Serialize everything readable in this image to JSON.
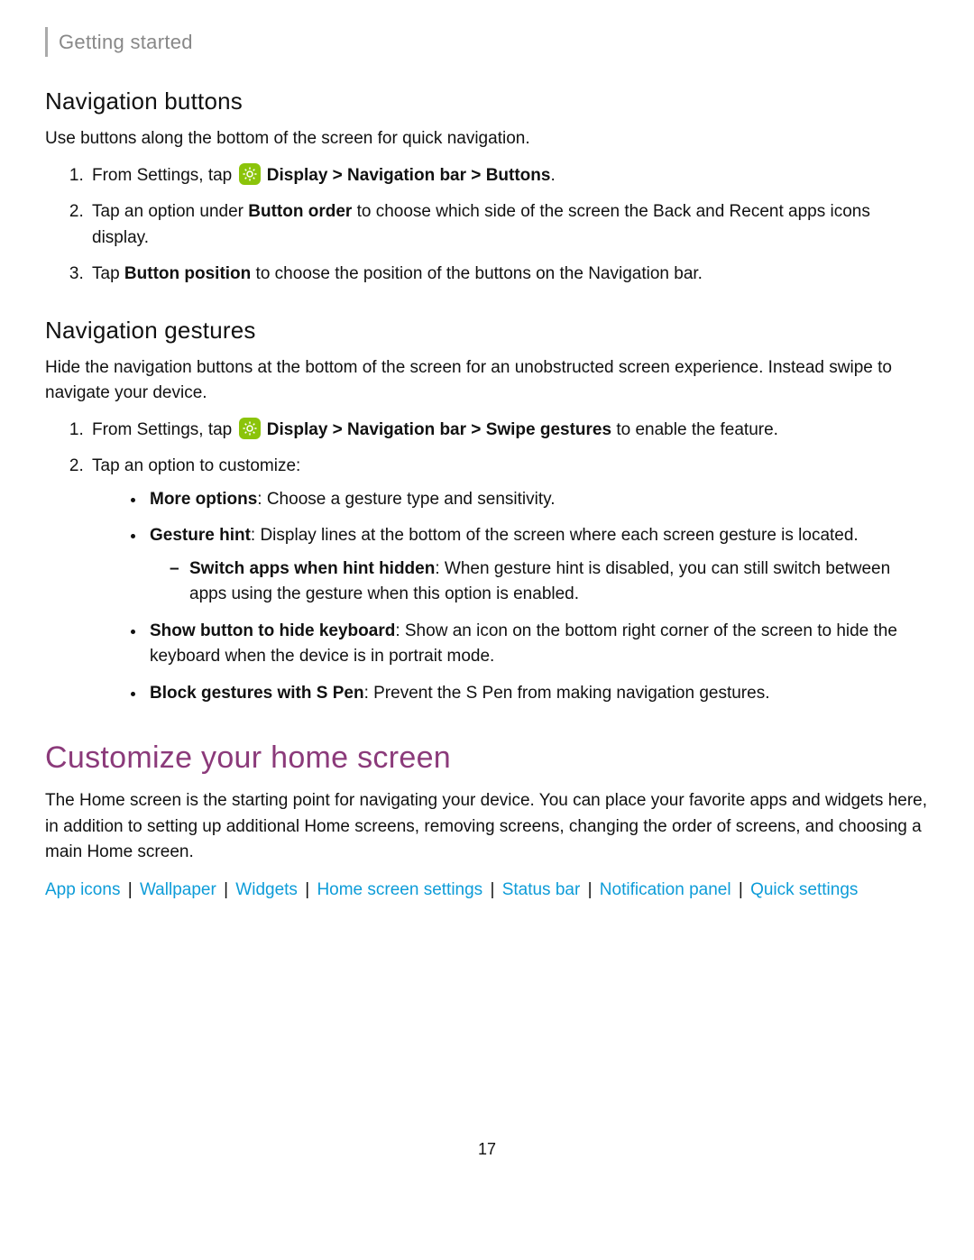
{
  "header": {
    "section": "Getting started"
  },
  "navButtons": {
    "heading": "Navigation buttons",
    "intro": "Use buttons along the bottom of the screen for quick navigation.",
    "step1_pre": "From Settings, tap ",
    "step1_b1": "Display",
    "step1_sep1": " > ",
    "step1_b2": "Navigation bar",
    "step1_sep2": " > ",
    "step1_b3": "Buttons",
    "step1_post": ".",
    "step2_pre": "Tap an option under ",
    "step2_b": "Button order",
    "step2_post": " to choose which side of the screen the Back and Recent apps icons display.",
    "step3_pre": "Tap ",
    "step3_b": "Button position",
    "step3_post": " to choose the position of the buttons on the Navigation bar."
  },
  "navGestures": {
    "heading": "Navigation gestures",
    "intro": "Hide the navigation buttons at the bottom of the screen for an unobstructed screen experience. Instead swipe to navigate your device.",
    "step1_pre": "From Settings, tap ",
    "step1_b1": "Display",
    "step1_sep1": " > ",
    "step1_b2": "Navigation bar",
    "step1_sep2": " > ",
    "step1_b3": "Swipe gestures",
    "step1_post": " to enable the feature.",
    "step2": "Tap an option to customize:",
    "bullets": {
      "more_b": "More options",
      "more_t": ": Choose a gesture type and sensitivity.",
      "hint_b": "Gesture hint",
      "hint_t": ": Display lines at the bottom of the screen where each screen gesture is located.",
      "switch_b": "Switch apps when hint hidden",
      "switch_t": ": When gesture hint is disabled, you can still switch between apps using the gesture when this option is enabled.",
      "kbd_b": "Show button to hide keyboard",
      "kbd_t": ": Show an icon on the bottom right corner of the screen to hide the keyboard when the device is in portrait mode.",
      "spen_b": "Block gestures with S Pen",
      "spen_t": ": Prevent the S Pen from making navigation gestures."
    }
  },
  "customize": {
    "heading": "Customize your home screen",
    "intro": "The Home screen is the starting point for navigating your device. You can place your favorite apps and widgets here, in addition to setting up additional Home screens, removing screens, changing the order of screens, and choosing a main Home screen.",
    "links": {
      "l0": "App icons",
      "l1": "Wallpaper",
      "l2": "Widgets",
      "l3": "Home screen settings",
      "l4": "Status bar",
      "l5": "Notification panel",
      "l6": "Quick settings",
      "sep": " | "
    }
  },
  "pageNumber": "17"
}
